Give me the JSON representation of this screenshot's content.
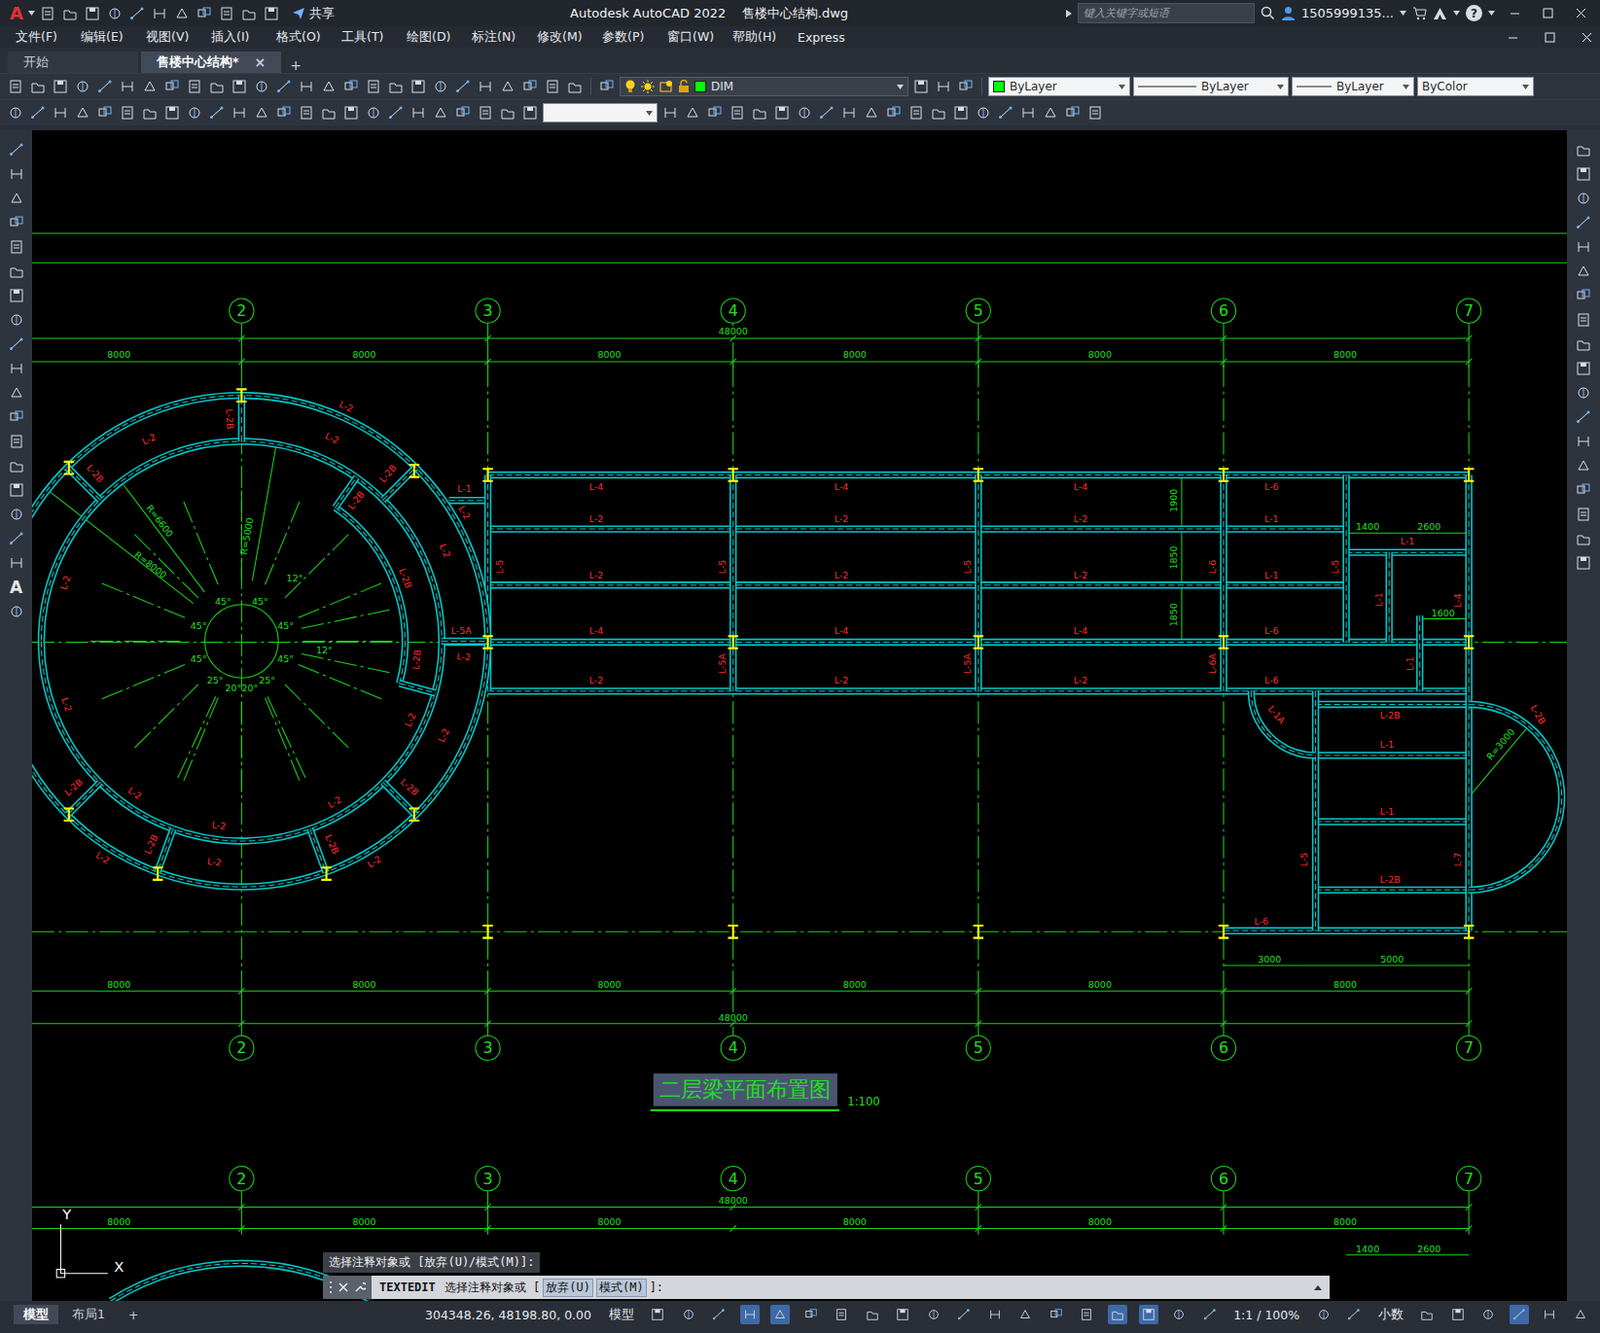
{
  "window": {
    "app_logo": "A",
    "title": "Autodesk AutoCAD 2022    售楼中心结构.dwg",
    "share": "共享",
    "search": {
      "placeholder": "键入关键字或短语"
    },
    "user": "1505999135...",
    "help": "?"
  },
  "menu": [
    "文件(F)",
    "编辑(E)",
    "视图(V)",
    "插入(I)",
    "格式(O)",
    "工具(T)",
    "绘图(D)",
    "标注(N)",
    "修改(M)",
    "参数(P)",
    "窗口(W)",
    "帮助(H)",
    "Express"
  ],
  "doc_tabs": [
    {
      "label": "开始",
      "selected": false
    },
    {
      "label": "售楼中心结构*",
      "selected": true
    }
  ],
  "tab_close": "×",
  "tab_add": "+",
  "properties": {
    "layer": "DIM",
    "layer_color": "#00ff00",
    "color": "ByLayer",
    "color_swatch": "#00ff00",
    "linetype": "ByLayer",
    "lineweight": "ByLayer",
    "plotstyle": "ByColor"
  },
  "left_toolbar": {
    "text_tool": "A"
  },
  "drawing": {
    "axis_rows": [
      [
        "2",
        "3",
        "4",
        "5",
        "6",
        "7"
      ],
      [
        "2",
        "3",
        "4",
        "5",
        "6",
        "7"
      ],
      [
        "2",
        "3",
        "4",
        "5",
        "6",
        "7"
      ]
    ],
    "dimensions": [
      "48000",
      "8000",
      "8000",
      "8000",
      "8000",
      "8000",
      "8000",
      "8000",
      "8000",
      "8000",
      "8000",
      "8000",
      "8000",
      "48000",
      "48000",
      "8000",
      "8000",
      "8000",
      "8000",
      "8000",
      "8000",
      "1400",
      "2600",
      "1600",
      "1900",
      "1850",
      "1850",
      "3000",
      "5000",
      "1400",
      "2600"
    ],
    "beam_labels": [
      "L-4",
      "L-4",
      "L-4",
      "L-6",
      "L-2",
      "L-2",
      "L-2",
      "L-1",
      "L-2",
      "L-2",
      "L-2",
      "L-1",
      "L-4",
      "L-4",
      "L-4",
      "L-6",
      "L-2",
      "L-2",
      "L-2",
      "L-6",
      "L-1",
      "L-2B",
      "L-1",
      "L-1",
      "L-2B",
      "L-6",
      "L-1",
      "L-5A",
      "L-5",
      "L-5",
      "L-5",
      "L-6",
      "L-5",
      "L-1",
      "L-4",
      "L-5A",
      "L-5A",
      "L-6A",
      "L-1",
      "L-5",
      "L-7",
      "L-1A",
      "L-2B"
    ],
    "ring_labels": [
      "L-2",
      "L-2B",
      "L-2",
      "L-2",
      "L-2B",
      "L-2B",
      "L-2B",
      "L-2",
      "L-2",
      "L-2",
      "L-2B",
      "L-2B",
      "L-2",
      "L-2",
      "L-2",
      "L-2",
      "L-2B",
      "L-2",
      "L-2",
      "L-2B",
      "L-2",
      "L-2B",
      "L-2",
      "L-2B",
      "L-2",
      "L-2"
    ],
    "annotations": [
      "R=6600",
      "R=8000",
      "R=5000",
      "45°",
      "45°",
      "45°",
      "45°",
      "45°",
      "45°",
      "12°",
      "12°",
      "25°",
      "20°",
      "20°",
      "25°",
      "R=3000"
    ],
    "title": {
      "text": "二层梁平面布置图",
      "selected": true
    },
    "scale": "1:100",
    "ucs": {
      "x": "X",
      "y": "Y"
    }
  },
  "command_line": {
    "history": "选择注释对象或 [放弃(U)/模式(M)]:",
    "command": "TEXTEDIT",
    "prompt": "选择注释对象或 [",
    "options": [
      "放弃(U)",
      "模式(M)"
    ],
    "prompt_end": "]:"
  },
  "layout_tabs": [
    {
      "label": "模型",
      "selected": true
    },
    {
      "label": "布局1",
      "selected": false
    }
  ],
  "layout_add": "+",
  "status_bar": {
    "coordinates": "304348.26, 48198.80, 0.00",
    "space": "模型",
    "scale": "1:1 / 100%",
    "units": "小数",
    "tools_before_scale": [
      {
        "on": false
      },
      {
        "on": false
      },
      {
        "on": false
      },
      {
        "on": true
      },
      {
        "on": true
      },
      {
        "on": false
      },
      {
        "on": false
      },
      {
        "on": false
      },
      {
        "on": false
      },
      {
        "on": false
      },
      {
        "on": false
      },
      {
        "on": false
      },
      {
        "on": false
      },
      {
        "on": false
      },
      {
        "on": false
      },
      {
        "on": true
      },
      {
        "on": true
      },
      {
        "on": false
      },
      {
        "on": false
      }
    ],
    "tools_after_scale": [
      {
        "on": false
      },
      {
        "on": false
      }
    ],
    "tools_after_units": [
      {
        "on": false
      },
      {
        "on": false
      },
      {
        "on": false
      },
      {
        "on": true
      },
      {
        "on": false
      },
      {
        "on": false
      }
    ]
  }
}
